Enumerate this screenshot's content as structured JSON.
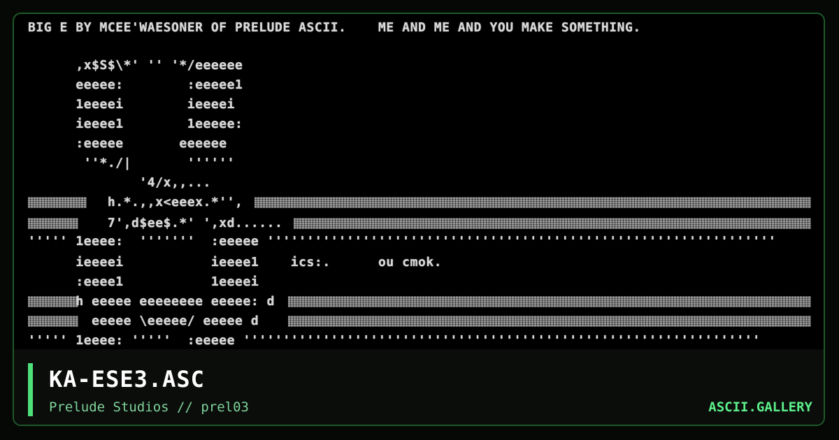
{
  "art": {
    "header": "BIG E BY MCEE'WAESONER OF PRELUDE ASCII.    ME AND ME AND YOU MAKE SOMETHING.",
    "lines": [
      "      ,x$S$\\*' '' '*/eeeeee",
      "      eeeee:        :eeeee1",
      "      1eeeei        ieeeei",
      "      ieeee1        1eeeee:",
      "      :eeeee       eeeeee",
      "       ''*./|       ''''''",
      "              '4/x,,...",
      "          h.*.,,x<eeex.*'',",
      "          7',d$ee$.*' ',xd......",
      "''''' 1eeee:  '''''''  :eeeee ''''''''''''''''''''''''''''''''''''''''''''''''''''''''''''''''",
      "      ieeeei           ieeee1    ics:.      ou cmok.",
      "      :eeee1           1eeeei",
      "      h eeeee eeeeeeee eeeee: d",
      "        eeeee \\eeeee/ eeeee d",
      "''''' 1eeee: '''''  :eeeee '''''''''''''''''''''''''''''''''''''''''''''''''''''''''''''''''"
    ]
  },
  "footer": {
    "title": "KA-ESE3.ASC",
    "subtitle": "Prelude Studios // prel03",
    "brand": "ASCII.GALLERY"
  },
  "colors": {
    "accent": "#4ee07a",
    "brand": "#5cf08a",
    "subtitle": "#7ed39a"
  }
}
